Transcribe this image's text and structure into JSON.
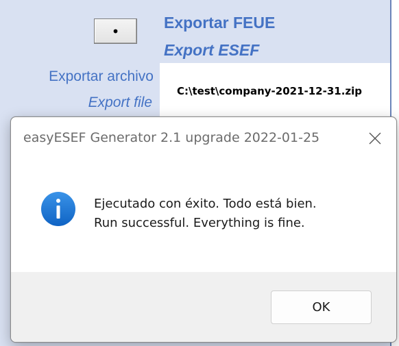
{
  "form": {
    "dot_button_label": "•",
    "export_title_es": "Exportar FEUE",
    "export_title_en": "Export ESEF",
    "export_file_label_es": "Exportar archivo",
    "export_file_label_en": "Export file",
    "export_file_path": "C:\\test\\company-2021-12-31.zip"
  },
  "dialog": {
    "title": "easyESEF Generator 2.1 upgrade 2022-01-25",
    "icon": "info-icon",
    "message_line1": "Ejecutado con éxito. Todo está bien.",
    "message_line2": "Run successful. Everything is fine.",
    "ok_label": "OK"
  },
  "colors": {
    "cell_background": "#d9e1f2",
    "label_blue": "#4472c4",
    "info_icon_blue": "#1e78d7"
  }
}
